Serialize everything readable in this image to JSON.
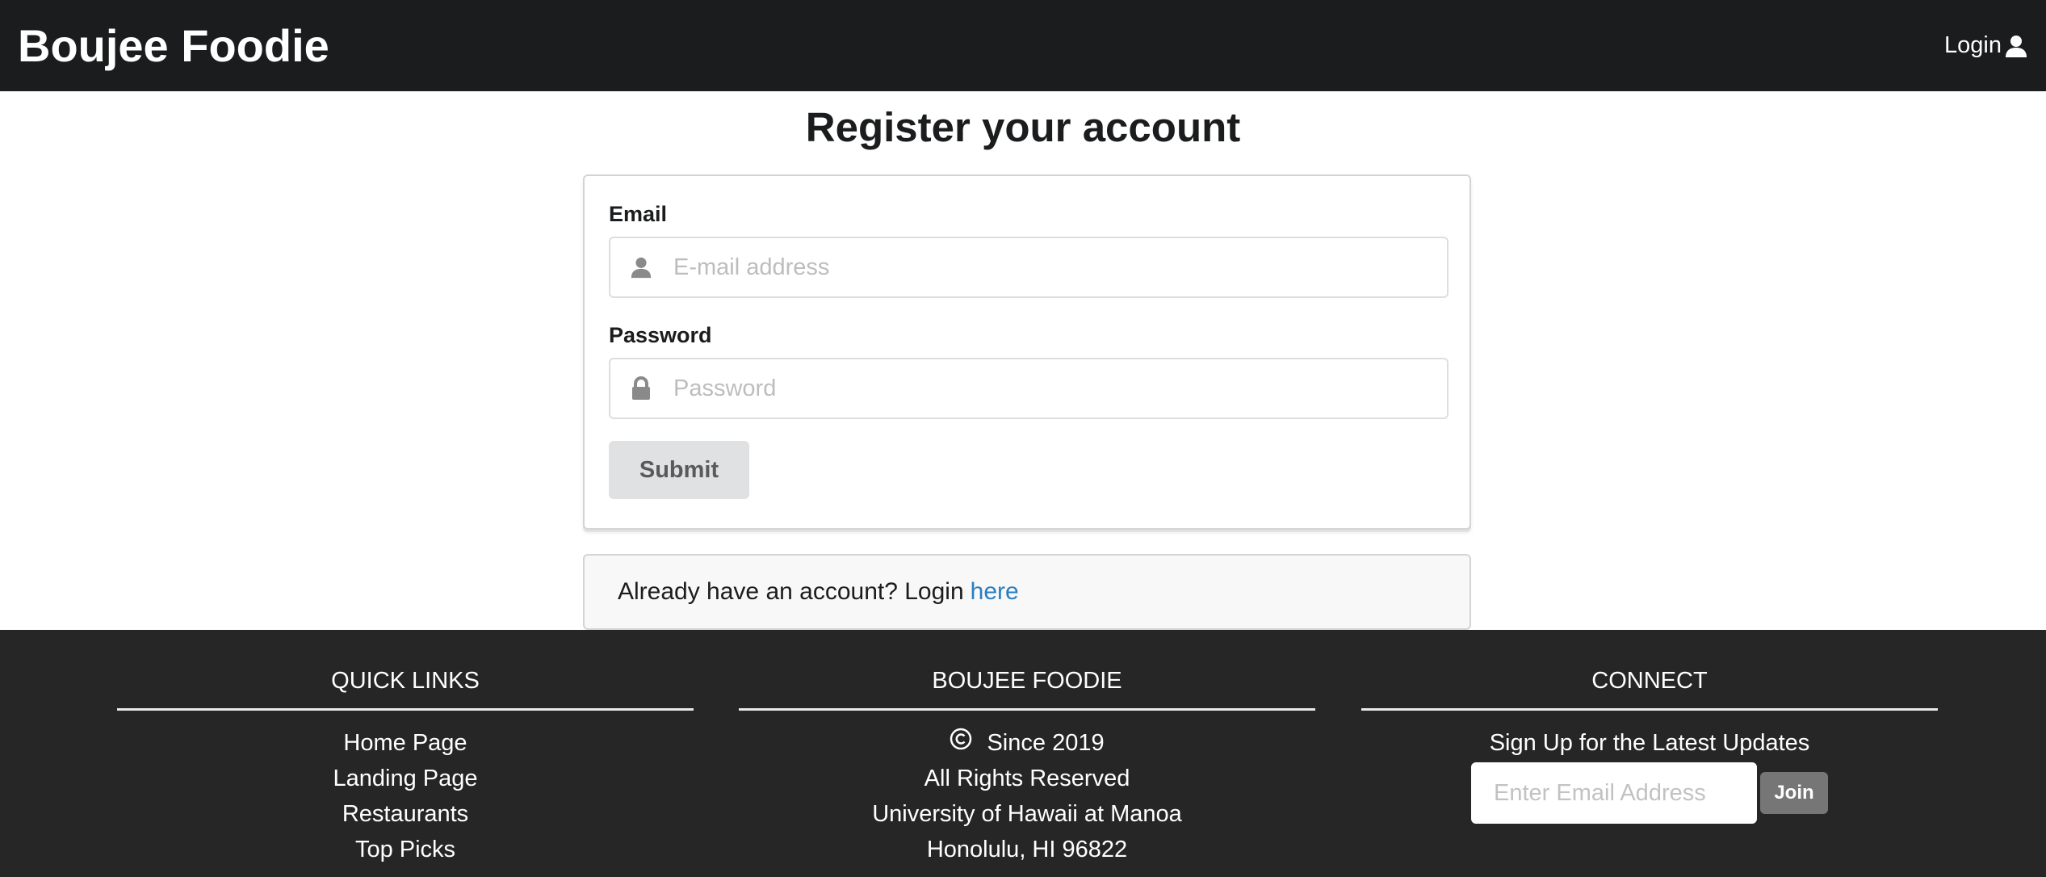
{
  "navbar": {
    "brand": "Boujee Foodie",
    "login_label": "Login"
  },
  "main": {
    "title": "Register your account",
    "form": {
      "email_label": "Email",
      "email_placeholder": "E-mail address",
      "password_label": "Password",
      "password_placeholder": "Password",
      "submit_label": "Submit"
    },
    "login_prompt": {
      "text": "Already have an account? Login",
      "link_label": "here"
    }
  },
  "footer": {
    "quick_links": {
      "heading": "QUICK LINKS",
      "items": [
        "Home Page",
        "Landing Page",
        "Restaurants",
        "Top Picks"
      ]
    },
    "about": {
      "heading": "BOUJEE FOODIE",
      "copyright": "Since 2019",
      "lines": [
        "All Rights Reserved",
        "University of Hawaii at Manoa",
        "Honolulu, HI 96822"
      ]
    },
    "connect": {
      "heading": "CONNECT",
      "tagline": "Sign Up for the Latest Updates",
      "email_placeholder": "Enter Email Address",
      "join_label": "Join"
    }
  },
  "colors": {
    "navbar_bg": "#1b1c1d",
    "footer_bg": "#262626",
    "link": "#2a7fc0",
    "button_bg": "#e0e1e2",
    "join_bg": "#767676"
  },
  "icons": {
    "login": "user-icon",
    "email_field": "user-icon",
    "password_field": "lock-icon",
    "copyright": "copyright-icon"
  }
}
